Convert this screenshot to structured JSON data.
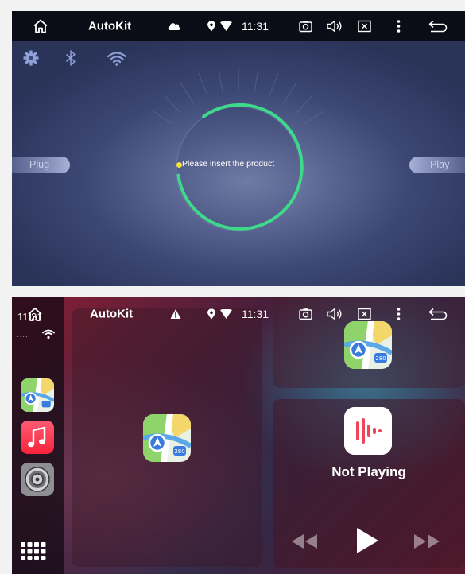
{
  "top_panel": {
    "statusbar": {
      "title": "AutoKit",
      "time": "11:31"
    },
    "center_message": "Please insert the product",
    "plug_label": "Plug",
    "play_label": "Play"
  },
  "bottom_panel": {
    "statusbar": {
      "title": "AutoKit",
      "time": "11:31"
    },
    "dock": {
      "time": "11:31",
      "signal_dots": "····"
    },
    "now_playing": {
      "label": "Not Playing"
    }
  },
  "colors": {
    "ring_green": "#3fd98a",
    "status_dot": "#f7e23a",
    "top_bg": "#3c4774",
    "bottom_bg": "#8a1f33"
  }
}
